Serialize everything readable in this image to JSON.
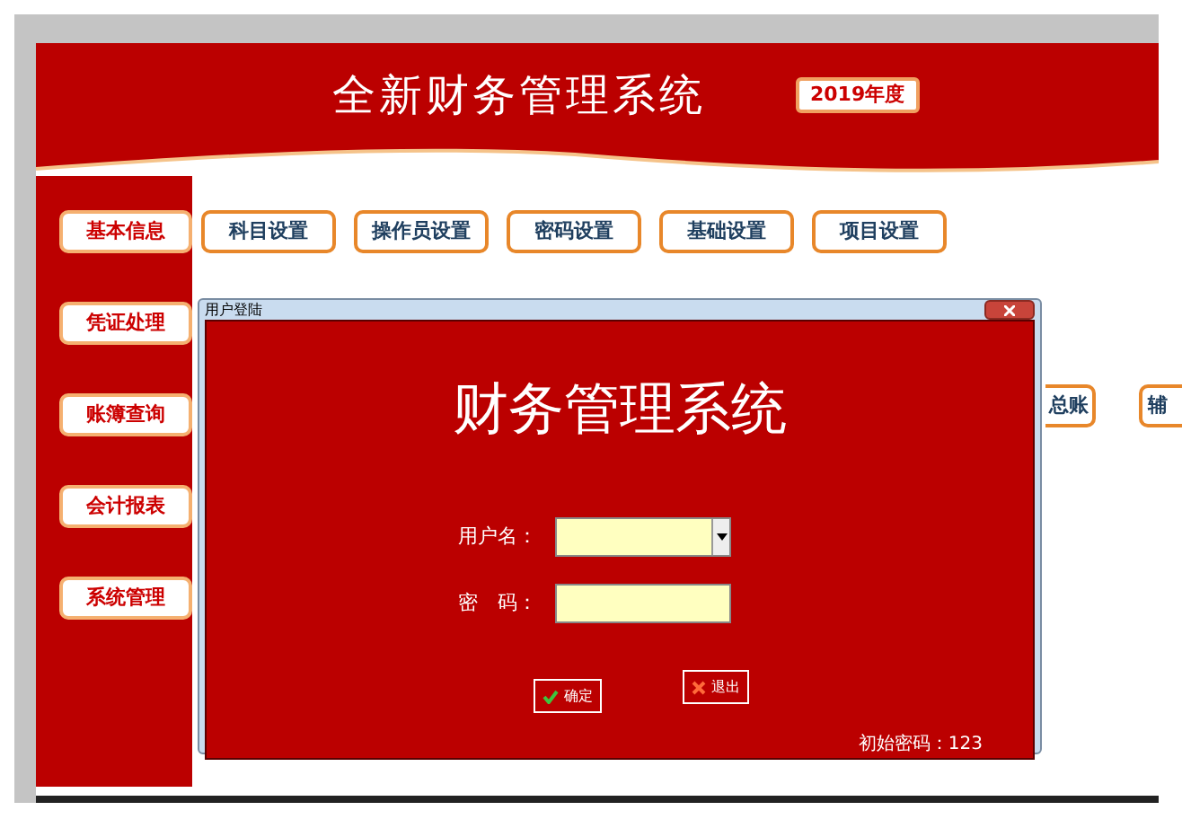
{
  "header": {
    "title": "全新财务管理系统",
    "year_badge": "2019年度"
  },
  "sidebar": {
    "items": [
      "基本信息",
      "凭证处理",
      "账簿查询",
      "会计报表",
      "系统管理"
    ]
  },
  "function_rows": [
    [
      "科目设置",
      "操作员设置",
      "密码设置",
      "基础设置",
      "项目设置"
    ],
    [
      "总账",
      "辅"
    ]
  ],
  "dialog": {
    "title": "用户登陆",
    "heading": "财务管理系统",
    "fields": [
      {
        "label": "用户名：",
        "kind": "dropdown"
      },
      {
        "label": "密　码：",
        "kind": "password"
      }
    ],
    "buttons": [
      {
        "label": "确定",
        "kind": "ok"
      },
      {
        "label": "退出",
        "kind": "cancel"
      }
    ],
    "note": "初始密码：123"
  }
}
